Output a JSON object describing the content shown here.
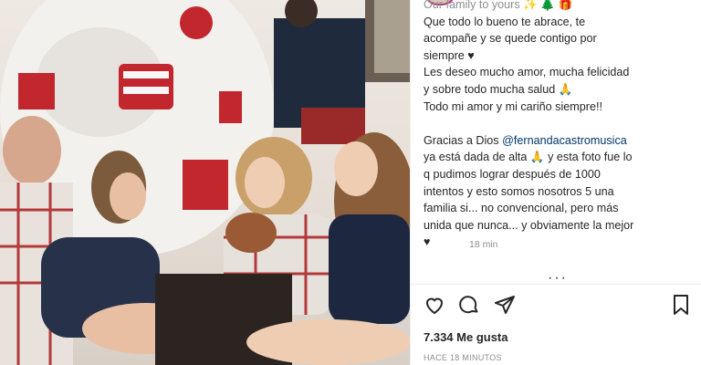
{
  "post": {
    "caption_top": "Our family to yours ✨ 🌲 🎁",
    "caption_lines": "Que todo lo bueno te abrace, te\nacompañe y se quede contigo por\nsiempre ♥\nLes deseo mucho amor, mucha felicidad\ny sobre todo mucha salud 🙏\nTodo mi amor y mi cariño siempre!!",
    "caption_thanks_1": "Gracias a Dios ",
    "mention": "@fernandacastromusica",
    "caption_thanks_2": "ya está dada de alta 🙏  y esta foto fue lo\nq pudimos lograr después de 1000\nintentos y esto somos nosotros 5 una\nfamilia si... no convencional, pero más\nunida que nunca... y obviamente la mejor\n♥",
    "comment_time": "18 min",
    "more": "···",
    "likes": "7.334 Me gusta",
    "time_ago": "HACE 18 MINUTOS"
  },
  "icons": {
    "like": "heart-icon",
    "comment": "comment-icon",
    "share": "send-icon",
    "save": "bookmark-icon"
  },
  "colors": {
    "text": "#262626",
    "muted": "#8e8e8e",
    "mention": "#00376b"
  }
}
